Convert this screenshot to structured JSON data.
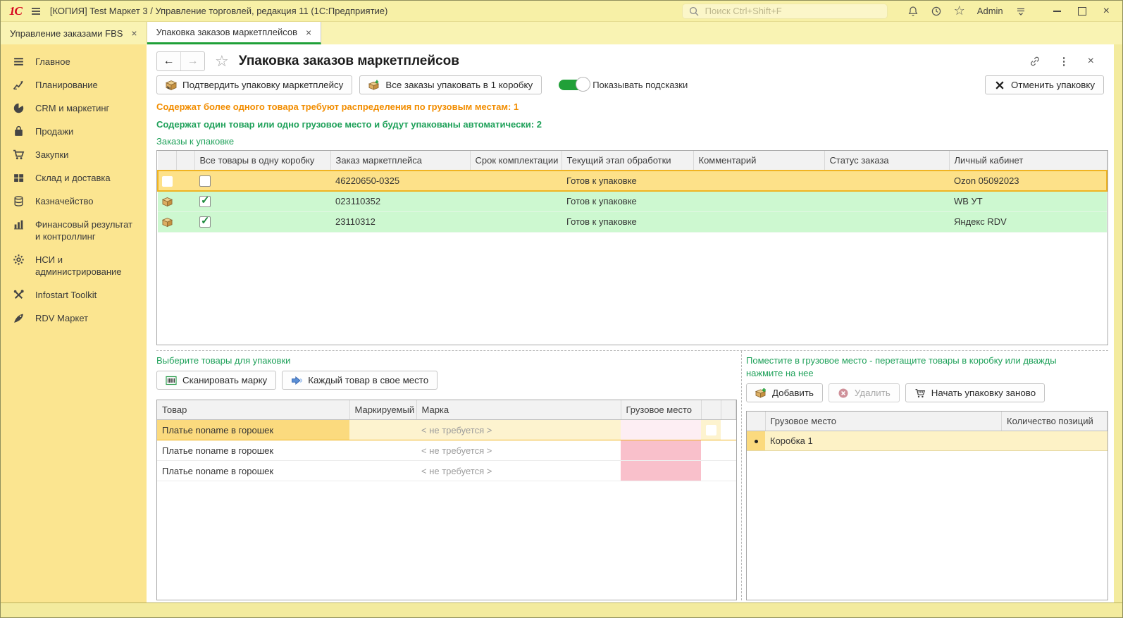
{
  "titlebar": {
    "logo": "1С",
    "app_title": "[КОПИЯ] Test Маркет 3 / Управление торговлей, редакция 11  (1С:Предприятие)",
    "search_placeholder": "Поиск Ctrl+Shift+F",
    "user": "Admin"
  },
  "glyphs": {
    "back": "←",
    "forward": "→",
    "favorite_star": "☆",
    "menu_dots": "⋮",
    "close": "×",
    "tab_close": "×"
  },
  "tabs": [
    {
      "label": "Управление заказами FBS",
      "active": false
    },
    {
      "label": "Упаковка заказов маркетплейсов",
      "active": true
    }
  ],
  "sidebar": {
    "items": [
      {
        "label": "Главное",
        "icon": "menu-icon"
      },
      {
        "label": "Планирование",
        "icon": "planning-chart-icon"
      },
      {
        "label": "CRM и маркетинг",
        "icon": "pie-chart-icon"
      },
      {
        "label": "Продажи",
        "icon": "shopping-bag-icon"
      },
      {
        "label": "Закупки",
        "icon": "shopping-cart-icon"
      },
      {
        "label": "Склад и доставка",
        "icon": "warehouse-grid-icon"
      },
      {
        "label": "Казначейство",
        "icon": "coins-icon"
      },
      {
        "label": "Финансовый результат и контроллинг",
        "icon": "bar-chart-icon"
      },
      {
        "label": "НСИ и администрирование",
        "icon": "gear-icon"
      },
      {
        "label": "Infostart Toolkit",
        "icon": "tools-icon"
      },
      {
        "label": "RDV Маркет",
        "icon": "rocket-icon"
      }
    ]
  },
  "page": {
    "title": "Упаковка заказов маркетплейсов",
    "toolbar": {
      "confirm_label": "Подтвердить упаковку маркетплейсу",
      "pack_all_label": "Все заказы упаковать в 1 коробку",
      "hints_toggle_label": "Показывать подсказки",
      "hints_toggle_on": true,
      "cancel_label": "Отменить упаковку"
    },
    "hint_orange": "Содержат более одного товара требуют распределения по грузовым местам: 1",
    "hint_green": "Содержат один товар или одно грузовое место и будут упакованы автоматически: 2",
    "orders": {
      "label": "Заказы к упаковке",
      "columns": {
        "pack_all": "Все товары в одну коробку",
        "order": "Заказ маркетплейса",
        "deadline": "Срок комплектации",
        "stage": "Текущий этап обработки",
        "comment": "Комментарий",
        "status": "Статус заказа",
        "account": "Личный кабинет"
      },
      "rows": [
        {
          "selected": true,
          "checked": false,
          "order": "46220650-0325",
          "deadline": "",
          "stage": "Готов к упаковке",
          "comment": "",
          "status": "",
          "account": "Ozon 05092023"
        },
        {
          "selected": false,
          "checked": true,
          "order": "023110352",
          "deadline": "",
          "stage": "Готов к упаковке",
          "comment": "",
          "status": "",
          "account": "WB УТ"
        },
        {
          "selected": false,
          "checked": true,
          "order": "23110312",
          "deadline": "",
          "stage": "Готов к упаковке",
          "comment": "",
          "status": "",
          "account": "Яндекс RDV"
        }
      ]
    },
    "products": {
      "label": "Выберите товары для упаковки",
      "scan_label": "Сканировать марку",
      "each_label": "Каждый товар в свое место",
      "columns": {
        "product": "Товар",
        "marked": "Маркируемый",
        "mark": "Марка",
        "cargo": "Грузовое место"
      },
      "rows": [
        {
          "selected": true,
          "product": "Платье noname в горошек",
          "marked": "",
          "mark": "< не требуется >",
          "cargo": ""
        },
        {
          "selected": false,
          "product": "Платье noname в горошек",
          "marked": "",
          "mark": "< не требуется >",
          "cargo": ""
        },
        {
          "selected": false,
          "product": "Платье noname в горошек",
          "marked": "",
          "mark": "< не требуется >",
          "cargo": ""
        }
      ]
    },
    "cargo": {
      "label": "Поместите в грузовое место - перетащите товары в коробку или дважды нажмите на нее",
      "add_label": "Добавить",
      "delete_label": "Удалить",
      "delete_enabled": false,
      "restart_label": "Начать упаковку заново",
      "columns": {
        "cargo": "Грузовое место",
        "count": "Количество позиций"
      },
      "rows": [
        {
          "name": "Коробка 1",
          "count": ""
        }
      ]
    }
  },
  "colors": {
    "accent_green": "#1fa038",
    "hint_orange": "#f28d00",
    "hint_green": "#1fa15a",
    "selected_row": "#fde189",
    "selected_border": "#f0b422",
    "auto_row": "#cdf8d0",
    "cargo_pink": "#f9c0cb",
    "sidebar_yellow": "#fbe590",
    "titlebar_yellow": "#f7f0a6"
  }
}
